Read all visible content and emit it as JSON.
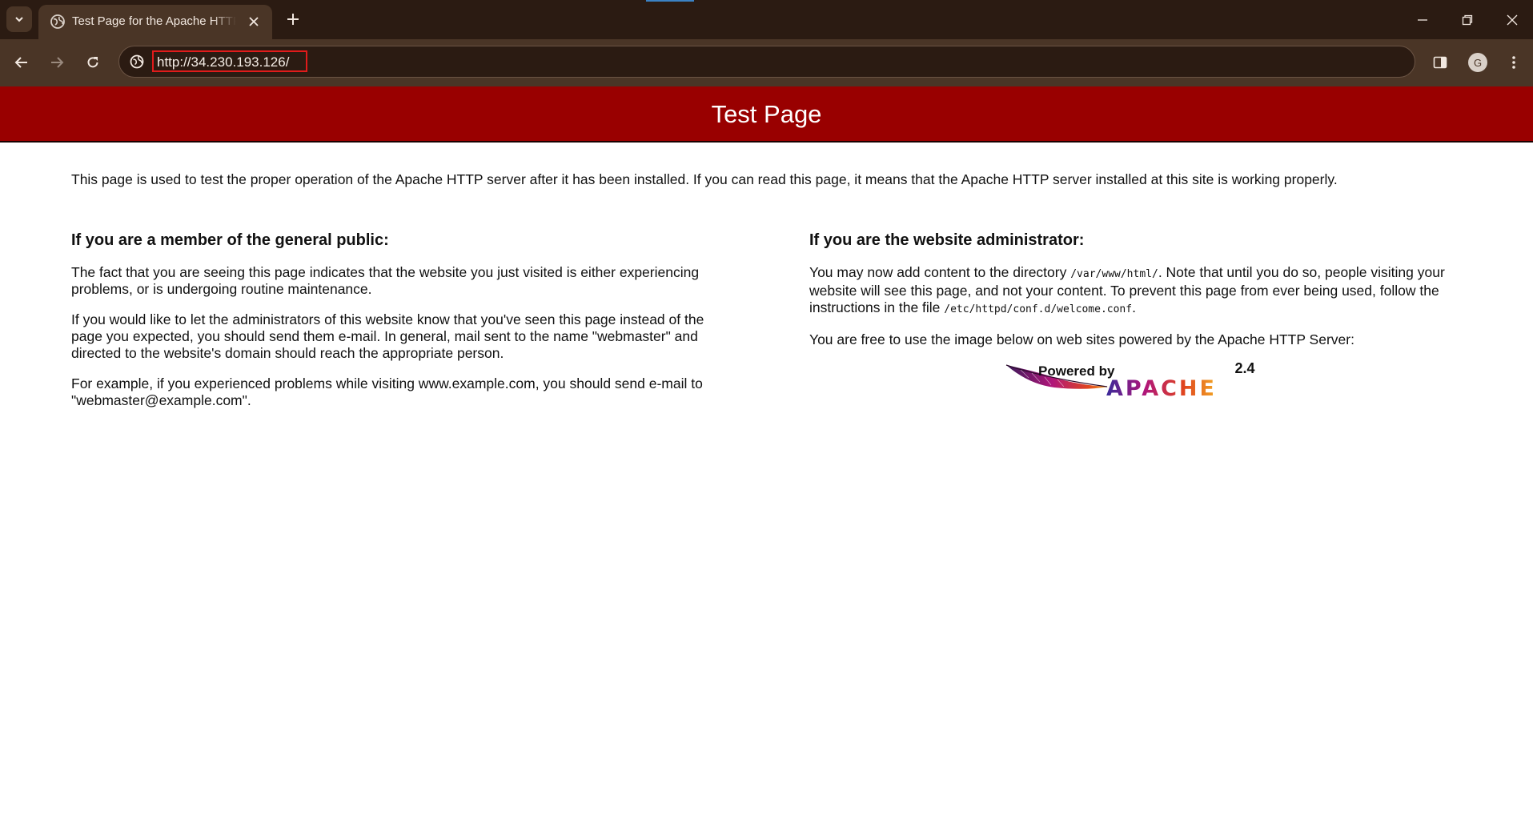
{
  "browser": {
    "tab_title": "Test Page for the Apache HTTP Server",
    "url": "http://34.230.193.126/",
    "profile_initial": "G"
  },
  "page": {
    "banner_title": "Test Page",
    "intro": "This page is used to test the proper operation of the Apache HTTP server after it has been installed. If you can read this page, it means that the Apache HTTP server installed at this site is working properly.",
    "public": {
      "heading": "If you are a member of the general public:",
      "p1": "The fact that you are seeing this page indicates that the website you just visited is either experiencing problems, or is undergoing routine maintenance.",
      "p2": "If you would like to let the administrators of this website know that you've seen this page instead of the page you expected, you should send them e-mail. In general, mail sent to the name \"webmaster\" and directed to the website's domain should reach the appropriate person.",
      "p3": "For example, if you experienced problems while visiting www.example.com, you should send e-mail to \"webmaster@example.com\"."
    },
    "admin": {
      "heading": "If you are the website administrator:",
      "p1_a": "You may now add content to the directory ",
      "p1_dir": "/var/www/html/",
      "p1_b": ". Note that until you do so, people visiting your website will see this page, and not your content. To prevent this page from ever being used, follow the instructions in the file ",
      "p1_file": "/etc/httpd/conf.d/welcome.conf",
      "p1_c": ".",
      "p2": "You are free to use the image below on web sites powered by the Apache HTTP Server:"
    },
    "powered_logo": {
      "powered_by": "Powered by",
      "brand": "APACHE",
      "version": "2.4"
    }
  }
}
